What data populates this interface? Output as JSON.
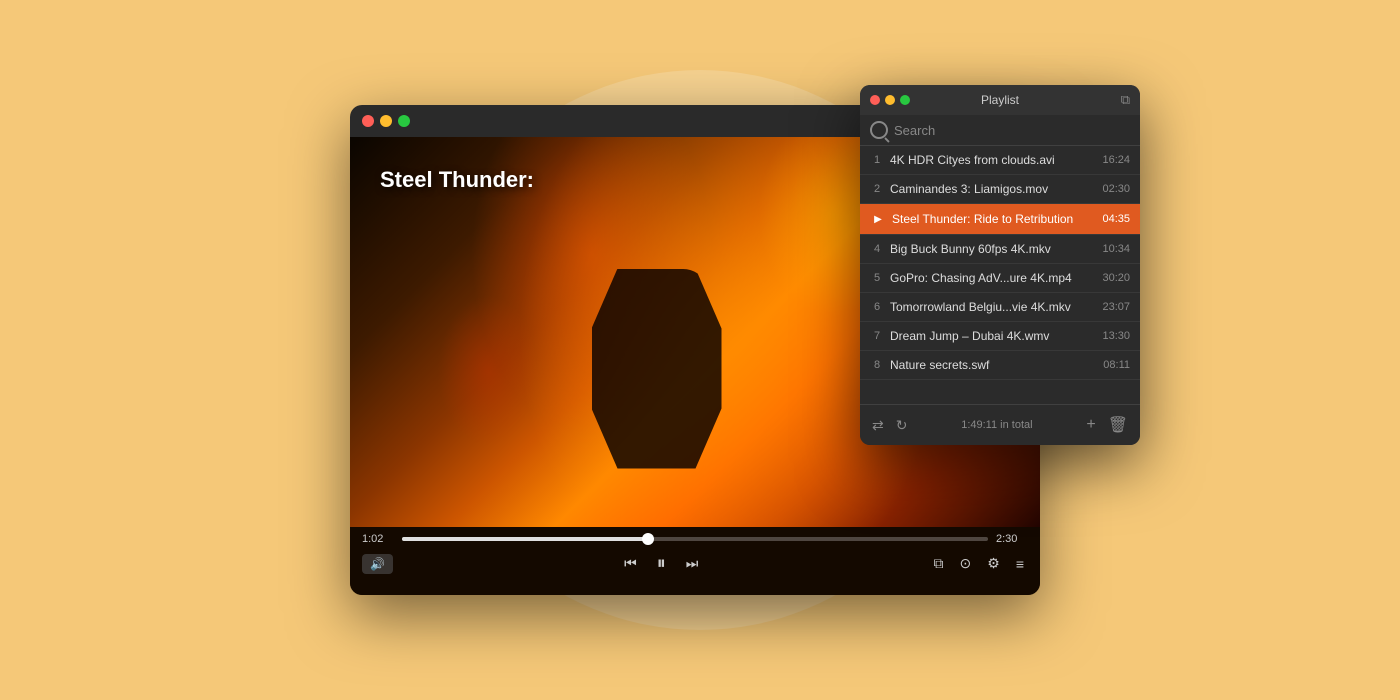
{
  "background": {
    "color": "#f5c878"
  },
  "player": {
    "title": "Steel Thunder:",
    "time_current": "1:02",
    "time_total": "2:30",
    "progress_percent": 42,
    "traffic_lights": [
      "red",
      "yellow",
      "green"
    ]
  },
  "playlist": {
    "title": "Playlist",
    "search_placeholder": "Search",
    "total_time": "1:49:11 in total",
    "items": [
      {
        "num": "1",
        "name": "4K HDR Cityes from clouds.avi",
        "duration": "16:24",
        "active": false
      },
      {
        "num": "2",
        "name": "Caminandes 3: Liamigos.mov",
        "duration": "02:30",
        "active": false
      },
      {
        "num": "3",
        "name": "Steel Thunder: Ride to Retribution",
        "duration": "04:35",
        "active": true
      },
      {
        "num": "4",
        "name": "Big Buck Bunny 60fps 4K.mkv",
        "duration": "10:34",
        "active": false
      },
      {
        "num": "5",
        "name": "GoPro: Chasing AdV...ure 4K.mp4",
        "duration": "30:20",
        "active": false
      },
      {
        "num": "6",
        "name": "Tomorrowland Belgiu...vie 4K.mkv",
        "duration": "23:07",
        "active": false
      },
      {
        "num": "7",
        "name": "Dream Jump – Dubai 4K.wmv",
        "duration": "13:30",
        "active": false
      },
      {
        "num": "8",
        "name": "Nature secrets.swf",
        "duration": "08:11",
        "active": false
      }
    ],
    "footer": {
      "shuffle_label": "⇄",
      "repeat_label": "↻",
      "add_label": "+",
      "delete_label": "🗑"
    }
  },
  "controls": {
    "volume_icon": "🔊",
    "prev_icon": "⏮",
    "pause_icon": "⏸",
    "next_icon": "⏭",
    "pip_icon": "⧉",
    "airplay_icon": "⊙",
    "settings_icon": "⚙",
    "playlist_icon": "≡"
  }
}
